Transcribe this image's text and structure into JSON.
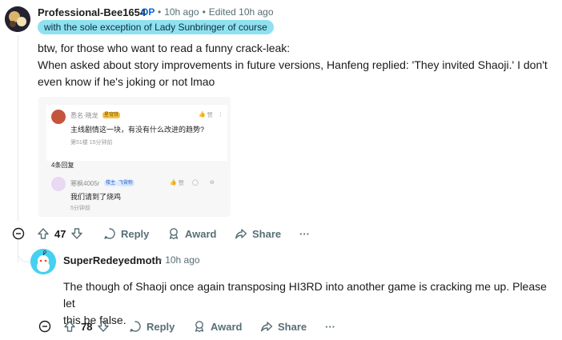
{
  "comment1": {
    "username": "Professional-Bee1654",
    "op_badge": "OP",
    "time": "10h ago",
    "edited": "Edited 10h ago",
    "flair": "with the sole exception of Lady Sunbringer of course",
    "body_line1": "btw, for those who want to read a funny crack-leak:",
    "body_line2": "When asked about story improvements in future versions, Hanfeng replied: 'They invited Shaoji.' I don't",
    "body_line3": "even know if he's joking or not lmao",
    "embed": {
      "q_user": "悉名·晓龙",
      "q_badge": "星穹铁",
      "q_like": "赞",
      "q_text": "主线剧情这一块，有没有什么改进的趋势?",
      "q_meta": "第51楼 15分钟前",
      "reply_count": "4条回复",
      "r_user": "寒枫4005r",
      "r_badge1": "楼主",
      "r_badge2": "飞霄粉",
      "r_like": "赞",
      "r_text": "我们请到了烧鸡",
      "r_meta": "5分钟前"
    },
    "votes": "47",
    "reply_label": "Reply",
    "award_label": "Award",
    "share_label": "Share",
    "more_label": "···"
  },
  "comment2": {
    "username": "SuperRedeyedmoth",
    "time": "10h ago",
    "body_line1": "The though of Shaoji once again transposing HI3RD into another game is cracking me up. Please let",
    "body_line2": "this be false.",
    "votes": "78",
    "reply_label": "Reply",
    "award_label": "Award",
    "share_label": "Share",
    "more_label": "···"
  },
  "colors": {
    "op_blue": "#0a66d8",
    "flair_bg": "#8fe1f1",
    "meta_gray": "#576f76",
    "thread_line": "#e5ebee",
    "avatar2_bg": "#46d1f0"
  }
}
